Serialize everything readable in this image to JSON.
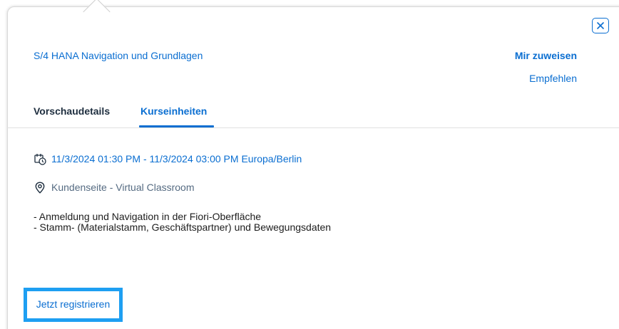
{
  "popover": {
    "course_title": "S/4 HANA Navigation und Grundlagen",
    "actions": {
      "assign_label": "Mir zuweisen",
      "recommend_label": "Empfehlen"
    },
    "close_icon": "close-icon"
  },
  "tabs": [
    {
      "label": "Vorschaudetails",
      "active": false
    },
    {
      "label": "Kurseinheiten",
      "active": true
    }
  ],
  "session": {
    "datetime": "11/3/2024 01:30 PM - 11/3/2024 03:00 PM Europa/Berlin",
    "datetime_icon": "calendar-clock-icon",
    "location": "Kundenseite - Virtual Classroom",
    "location_icon": "location-pin-icon",
    "description_lines": [
      "- Anmeldung und Navigation in der Fiori-Oberfläche",
      "- Stamm- (Materialstamm, Geschäftspartner) und Bewegungsdaten"
    ]
  },
  "register_button": {
    "label": "Jetzt registrieren"
  },
  "colors": {
    "accent": "#0a6ed1",
    "highlight": "#1e9ff2",
    "text_dark": "#1d2d3e",
    "text_muted": "#556b82"
  }
}
